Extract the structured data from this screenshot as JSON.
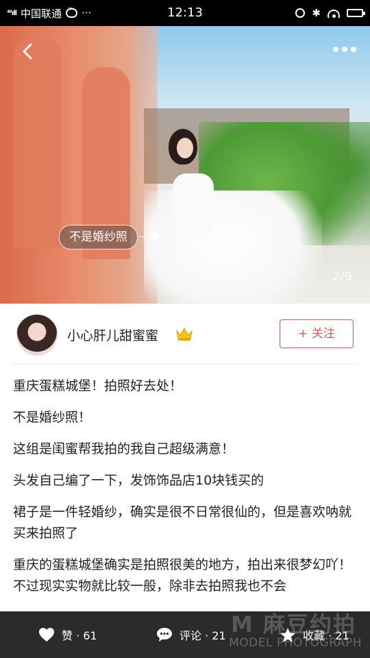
{
  "status_bar": {
    "carrier": "中国联通",
    "signal": "⁴⁶ıll",
    "more": "···",
    "time": "12:13"
  },
  "photo": {
    "tag_label": "不是婚纱照",
    "counter": "2/9"
  },
  "author": {
    "name": "小心肝儿甜蜜蜜",
    "follow_label": "+ 关注"
  },
  "post": {
    "paragraphs": [
      "重庆蛋糕城堡！拍照好去处！",
      "不是婚纱照！",
      "这组是闺蜜帮我拍的我自己超级满意！",
      "头发自己编了一下，发饰饰品店10块钱买的",
      "裙子是一件轻婚纱，确实是很不日常很仙的，但是喜欢呐就买来拍照了",
      "重庆的蛋糕城堡确实是拍照很美的地方，拍出来很梦幻吖！不过现实实物就比较一般，除非去拍照我也不会"
    ]
  },
  "bottom_bar": {
    "like_label": "赞 · 61",
    "comment_label": "评论 · 21",
    "favorite_label": "收藏 · 21"
  },
  "watermark": {
    "main": "M 麻豆约拍",
    "sub": "MODEL PHOTOGRAPH"
  },
  "colors": {
    "accent": "#e8505b",
    "bottom_bar": "#2b2b2b"
  }
}
